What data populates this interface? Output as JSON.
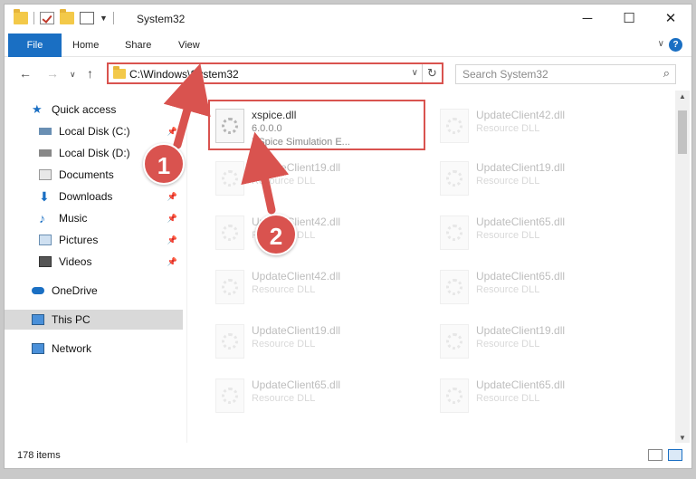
{
  "window": {
    "title": "System32",
    "controls": {
      "minimize": "─",
      "maximize": "☐",
      "close": "✕"
    }
  },
  "ribbon": {
    "tabs": [
      {
        "label": "File"
      },
      {
        "label": "Home"
      },
      {
        "label": "Share"
      },
      {
        "label": "View"
      }
    ],
    "help_label": "?"
  },
  "nav": {
    "address": "C:\\Windows\\System32",
    "search_placeholder": "Search System32"
  },
  "sidebar": {
    "items": [
      {
        "label": "Quick access"
      },
      {
        "label": "Local Disk (C:)"
      },
      {
        "label": "Local Disk (D:)"
      },
      {
        "label": "Documents"
      },
      {
        "label": "Downloads"
      },
      {
        "label": "Music"
      },
      {
        "label": "Pictures"
      },
      {
        "label": "Videos"
      },
      {
        "label": "OneDrive"
      },
      {
        "label": "This PC"
      },
      {
        "label": "Network"
      }
    ]
  },
  "files": {
    "items": [
      {
        "name": "xspice.dll",
        "line2": "6.0.0.0",
        "line3": "XSpice Simulation E..."
      },
      {
        "name": "UpdateClient42.dll",
        "line2": "Resource DLL"
      },
      {
        "name": "UpdateClient19.dll",
        "line2": "Resource DLL"
      },
      {
        "name": "UpdateClient19.dll",
        "line2": "Resource DLL"
      },
      {
        "name": "UpdateClient42.dll",
        "line2": "Resource DLL"
      },
      {
        "name": "UpdateClient65.dll",
        "line2": "Resource DLL"
      },
      {
        "name": "UpdateClient42.dll",
        "line2": "Resource DLL"
      },
      {
        "name": "UpdateClient65.dll",
        "line2": "Resource DLL"
      },
      {
        "name": "UpdateClient19.dll",
        "line2": "Resource DLL"
      },
      {
        "name": "UpdateClient19.dll",
        "line2": "Resource DLL"
      },
      {
        "name": "UpdateClient65.dll",
        "line2": "Resource DLL"
      },
      {
        "name": "UpdateClient65.dll",
        "line2": "Resource DLL"
      }
    ]
  },
  "status": {
    "item_count": "178 items"
  },
  "callouts": {
    "one": "1",
    "two": "2"
  },
  "colors": {
    "accent": "#1a6fc3",
    "callout": "#d9534f",
    "selected": "#d9d9d9"
  }
}
